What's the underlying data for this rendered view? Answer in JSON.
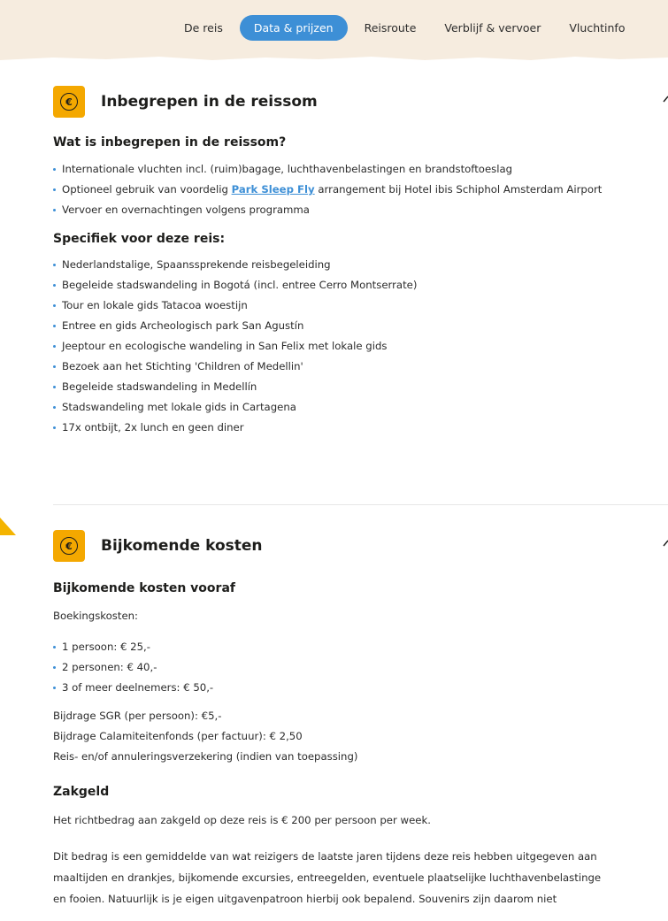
{
  "nav": {
    "tabs": [
      {
        "label": "De reis",
        "active": false
      },
      {
        "label": "Data & prijzen",
        "active": true
      },
      {
        "label": "Reisroute",
        "active": false
      },
      {
        "label": "Verblijf & vervoer",
        "active": false
      },
      {
        "label": "Vluchtinfo",
        "active": false
      }
    ]
  },
  "colors": {
    "accent": "#3d8fd6",
    "badge": "#f4a800",
    "band": "#f6ecdf"
  },
  "included": {
    "title": "Inbegrepen in de reissom",
    "icon": "euro-icon",
    "question": "Wat is inbegrepen in de reissom?",
    "items": [
      "Internationale vluchten incl. (ruim)bagage, luchthavenbelastingen en brandstoftoeslag",
      {
        "pre": "Optioneel gebruik van voordelig ",
        "link": "Park Sleep Fly",
        "post": " arrangement bij Hotel ibis Schiphol Amsterdam Airport"
      },
      "Vervoer en overnachtingen volgens programma"
    ],
    "specific_title": "Specifiek voor deze reis:",
    "specific_items": [
      "Nederlandstalige, Spaanssprekende reisbegeleiding",
      "Begeleide stadswandeling in Bogotá (incl. entree Cerro Montserrate)",
      "Tour en lokale gids Tatacoa woestijn",
      "Entree en gids Archeologisch park San Agustín",
      "Jeeptour en ecologische wandeling in San Felix met lokale gids",
      "Bezoek aan het Stichting 'Children of Medellin'",
      "Begeleide stadswandeling in Medellín",
      "Stadswandeling met lokale gids in Cartagena",
      "17x ontbijt, 2x lunch en geen diner"
    ]
  },
  "extra": {
    "title": "Bijkomende kosten",
    "icon": "euro-icon",
    "pre_title": "Bijkomende kosten vooraf",
    "booking_label": "Boekingskosten:",
    "booking_items": [
      "1 persoon: € 25,-",
      "2 personen: € 40,-",
      "3 of meer deelnemers: € 50,-"
    ],
    "lines": [
      "Bijdrage SGR (per persoon): €5,-",
      "Bijdrage Calamiteitenfonds (per factuur): € 2,50",
      "Reis- en/of annuleringsverzekering (indien van toepassing)"
    ],
    "pocket_title": "Zakgeld",
    "pocket_line": "Het richtbedrag aan zakgeld op deze reis is € 200 per persoon per week.",
    "pocket_para": [
      "Dit bedrag is een gemiddelde van wat reizigers de laatste jaren tijdens deze reis hebben uitgegeven aan",
      "maaltijden en drankjes, bijkomende excursies, entreegelden, eventuele plaatselijke luchthavenbelastinge",
      "en fooien. Natuurlijk is je eigen uitgavenpatroon hierbij ook bepalend. Souvenirs zijn daarom niet"
    ]
  }
}
